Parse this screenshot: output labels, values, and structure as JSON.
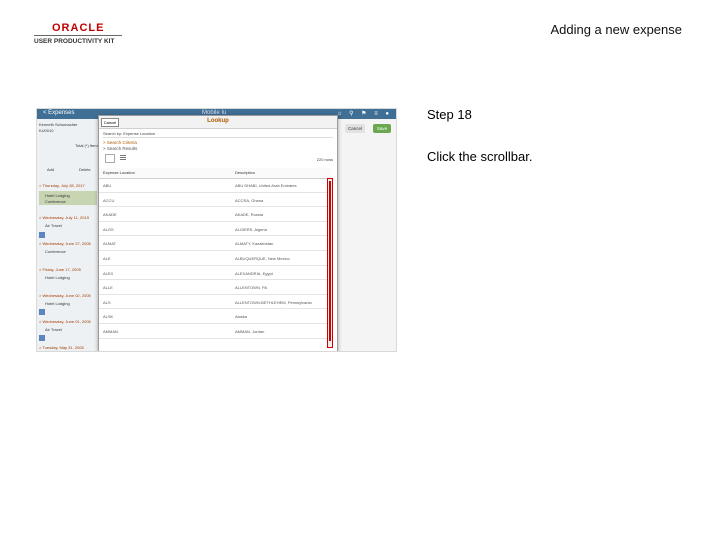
{
  "header": {
    "logo_word": "ORACLE",
    "logo_sub": "USER PRODUCTIVITY KIT",
    "title": "Adding a new expense"
  },
  "step": {
    "label": "Step 18",
    "instruction": "Click the scrollbar."
  },
  "screenshot": {
    "app_title": "< Expenses",
    "center_title": "Mobile Iu",
    "icons": [
      "home-icon",
      "search-icon",
      "flag-icon",
      "menu-icon",
      "user-icon"
    ],
    "buttons": {
      "cancel": "Cancel",
      "save": "Save"
    },
    "left_panel": {
      "rows": [
        "Kenneth Schumacher",
        "KU0010",
        "Total (*) Items",
        "Add",
        "Delete",
        "> Thursday, July 28, 2017",
        "Hotel Lodging",
        "Conference",
        "> Wednesday, July 11, 2015",
        "Air Travel",
        "> Wednesday, June 27, 2005",
        "Conference",
        "> Friday, June 17, 2005",
        "Hotel Lodging",
        "> Wednesday, June 02, 2005",
        "Hotel Lodging",
        "> Wednesday, June 01, 2005",
        "Air Travel",
        "> Tuesday, May 31, 2005"
      ]
    },
    "lookup": {
      "cancel": "Cancel",
      "title": "Lookup",
      "search_text": "Search by: Expense Location",
      "section1": "> Search Criteria",
      "section2": "> Search Results",
      "count": "220 rows",
      "columns": [
        "Expense Location",
        "Description"
      ],
      "rows": [
        [
          "ABU",
          "ABU DHABI, United Arab Emirates"
        ],
        [
          "ACCU",
          "ACCRA, Ghana"
        ],
        [
          "AKADE",
          "AKADE, Russia"
        ],
        [
          "ALGS",
          "ALGIERS, Algeria"
        ],
        [
          "ALMAT",
          "ALMATY, Kazakhstan"
        ],
        [
          "ALE",
          "ALBUQUERQUE, New Mexico"
        ],
        [
          "ALEX",
          "ALEXANDRIA, Egypt"
        ],
        [
          "ALLE",
          "ALLENTOWN, PA"
        ],
        [
          "ALS",
          "ALLENTOWN-BETHLEHEM, Pennsylvania"
        ],
        [
          "ALSK",
          "Alaska"
        ],
        [
          "AMMAN",
          "AMMAN, Jordan"
        ]
      ]
    }
  }
}
